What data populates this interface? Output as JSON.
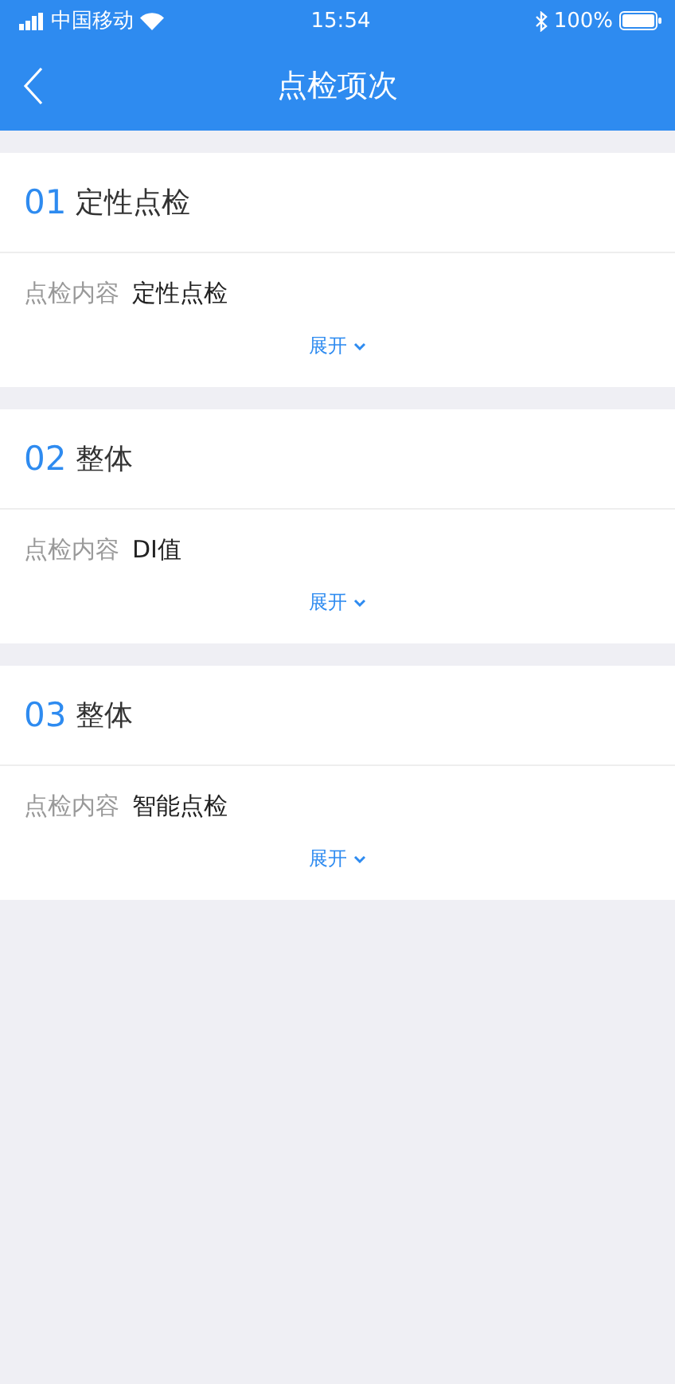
{
  "status_bar": {
    "carrier": "中国移动",
    "time": "15:54",
    "battery": "100%"
  },
  "nav": {
    "title": "点检项次"
  },
  "items": [
    {
      "number": "01",
      "name": "定性点检",
      "content_label": "点检内容",
      "content": "定性点检",
      "expand": "展开"
    },
    {
      "number": "02",
      "name": "整体",
      "content_label": "点检内容",
      "content": "DI值",
      "expand": "展开"
    },
    {
      "number": "03",
      "name": "整体",
      "content_label": "点检内容",
      "content": "智能点检",
      "expand": "展开"
    }
  ]
}
